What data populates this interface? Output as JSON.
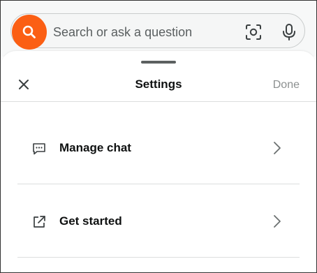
{
  "search": {
    "placeholder": "Search or ask a question",
    "button_icon": "search-icon",
    "camera_icon": "camera-scan-icon",
    "mic_icon": "microphone-icon",
    "accent_color": "#fb5f14"
  },
  "settings_sheet": {
    "title": "Settings",
    "close_icon": "close-icon",
    "done_label": "Done",
    "items": [
      {
        "label": "Manage chat",
        "icon": "chat-bubble-icon",
        "trailing_icon": "chevron-right-icon"
      },
      {
        "label": "Get started",
        "icon": "external-link-icon",
        "trailing_icon": "chevron-right-icon"
      }
    ]
  }
}
